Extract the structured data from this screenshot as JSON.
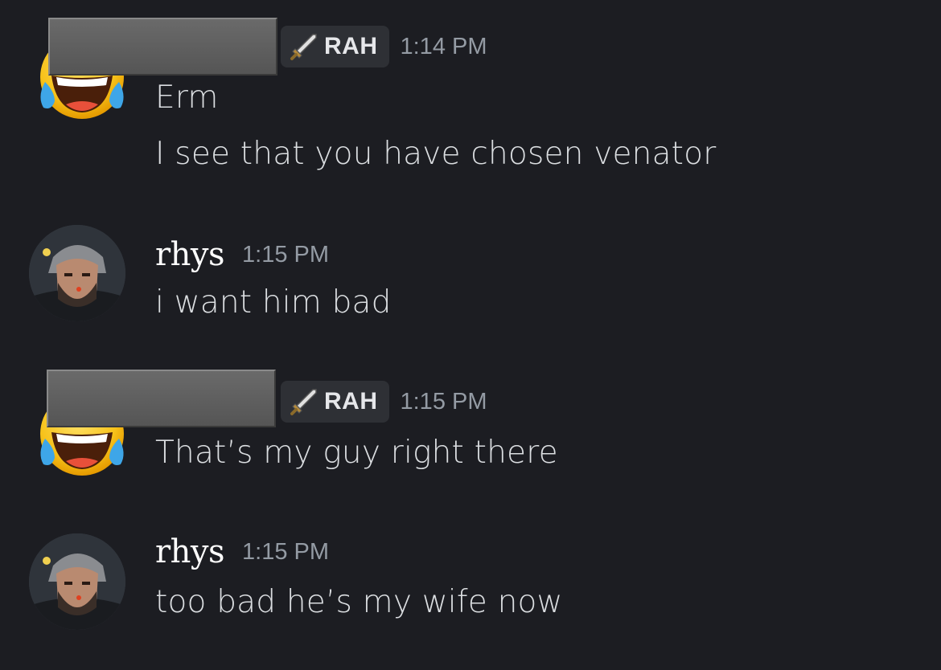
{
  "messages": [
    {
      "author_redacted": true,
      "role_tag": "RAH",
      "role_icon": "sword-icon",
      "avatar": "tears-of-joy-emoji-avatar",
      "time": "1:14 PM",
      "lines": [
        "Erm",
        "I see that you have chosen venator"
      ]
    },
    {
      "author": "rhys",
      "avatar": "bearded-character-avatar",
      "time": "1:15 PM",
      "lines": [
        "i want him bad"
      ]
    },
    {
      "author_redacted": true,
      "role_tag": "RAH",
      "role_icon": "sword-icon",
      "avatar": "tears-of-joy-emoji-avatar",
      "time": "1:15 PM",
      "lines": [
        "That’s my guy right there"
      ]
    },
    {
      "author": "rhys",
      "avatar": "bearded-character-avatar",
      "time": "1:15 PM",
      "lines": [
        "too bad he’s my wife now"
      ]
    }
  ],
  "colors": {
    "background": "#1c1d22",
    "text": "#dbdee1",
    "timestamp": "#949ba4",
    "tag_bg": "#2e3035",
    "username": "#ffffff"
  }
}
